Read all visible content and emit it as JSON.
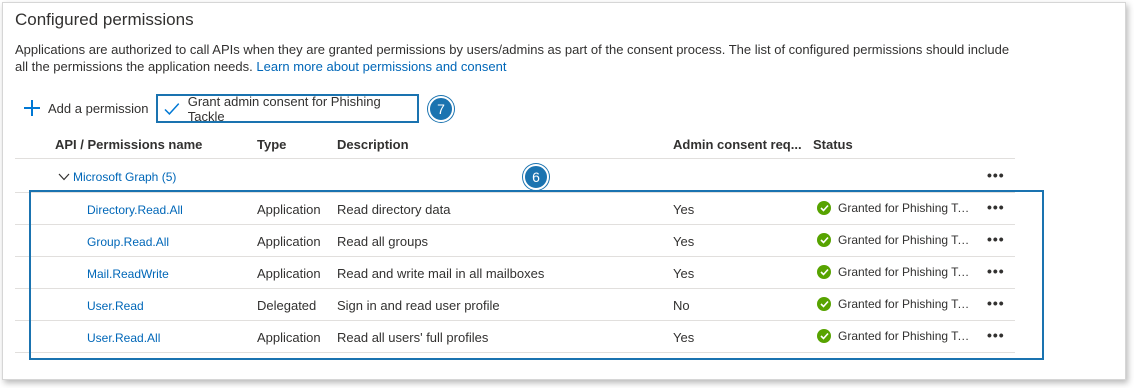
{
  "section": {
    "title": "Configured permissions",
    "description": "Applications are authorized to call APIs when they are granted permissions by users/admins as part of the consent process. The list of configured permissions should include all the permissions the application needs.",
    "learn_more": "Learn more about permissions and consent"
  },
  "toolbar": {
    "add_label": "Add a permission",
    "grant_label": "Grant admin consent for Phishing Tackle"
  },
  "callouts": {
    "grant": "7",
    "rows": "6"
  },
  "table": {
    "columns": {
      "name": "API / Permissions name",
      "type": "Type",
      "description": "Description",
      "admin_consent": "Admin consent req...",
      "status": "Status"
    },
    "group": {
      "label": "Microsoft Graph (5)",
      "more": "•••"
    },
    "rows": [
      {
        "name": "Directory.Read.All",
        "type": "Application",
        "description": "Read directory data",
        "admin_consent": "Yes",
        "status": "Granted for Phishing Tackle",
        "more": "•••"
      },
      {
        "name": "Group.Read.All",
        "type": "Application",
        "description": "Read all groups",
        "admin_consent": "Yes",
        "status": "Granted for Phishing Tackle",
        "more": "•••"
      },
      {
        "name": "Mail.ReadWrite",
        "type": "Application",
        "description": "Read and write mail in all mailboxes",
        "admin_consent": "Yes",
        "status": "Granted for Phishing Tackle",
        "more": "•••"
      },
      {
        "name": "User.Read",
        "type": "Delegated",
        "description": "Sign in and read user profile",
        "admin_consent": "No",
        "status": "Granted for Phishing Tackle",
        "more": "•••"
      },
      {
        "name": "User.Read.All",
        "type": "Application",
        "description": "Read all users' full profiles",
        "admin_consent": "Yes",
        "status": "Granted for Phishing Tackle",
        "more": "•••"
      }
    ]
  },
  "colors": {
    "accent": "#0078d4",
    "link": "#0067b8",
    "granted": "#57a300",
    "callout": "#1a73b0"
  },
  "icons": {
    "add": "plus-icon",
    "grant": "checkmark-icon",
    "group": "chevron-down-icon",
    "status": "check-circle-icon",
    "row_menu": "more-icon"
  }
}
